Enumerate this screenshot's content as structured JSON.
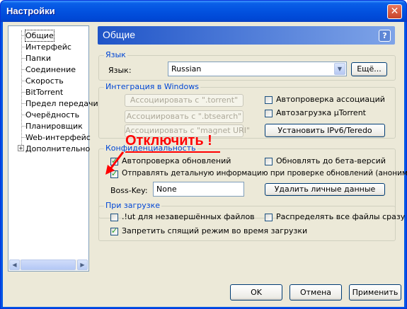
{
  "window": {
    "title": "Настройки",
    "close_glyph": "✕"
  },
  "tree": {
    "items": [
      "Общие",
      "Интерфейс",
      "Папки",
      "Соединение",
      "Скорость",
      "BitTorrent",
      "Предел передачи",
      "Очерёдность",
      "Планировщик",
      "Web-интерфейс",
      "Дополнительно"
    ],
    "selected": "Общие",
    "expander": "+"
  },
  "header": {
    "title": "Общие",
    "help": "?"
  },
  "lang": {
    "group": "Язык",
    "label": "Язык:",
    "value": "Russian",
    "more_button": "Ещё..."
  },
  "integration": {
    "group": "Интеграция в Windows",
    "assoc_torrent": "Ассоциировать с \".torrent\"",
    "assoc_btsearch": "Ассоциировать с \".btsearch\"",
    "assoc_magnet": "Ассоциировать с \"magnet URI\"",
    "check_assoc": "Автопроверка ассоциаций",
    "autostart": "Автозагрузка µTorrent",
    "ipv6_button": "Установить IPv6/Teredo"
  },
  "privacy": {
    "group": "Конфиденциальность",
    "auto_update": "Автопроверка обновлений",
    "beta": "Обновлять до бета-версий",
    "send_info": "Отправлять детальную информацию при проверке обновлений (анонимно)",
    "boss_label": "Boss-Key:",
    "boss_value": "None",
    "delete_button": "Удалить личные данные"
  },
  "download": {
    "group": "При загрузке",
    "ut_ext": ".!ut для незавершённых файлов",
    "prealloc": "Распределять все файлы сразу",
    "no_sleep": "Запретить спящий режим во время загрузки"
  },
  "annotation": {
    "text": "Отключить !"
  },
  "buttons": {
    "ok": "OK",
    "cancel": "Отмена",
    "apply": "Применить"
  },
  "colors": {
    "accent": "#0046d5",
    "annotation": "#ff0000",
    "titlebar": "#0055e5"
  }
}
